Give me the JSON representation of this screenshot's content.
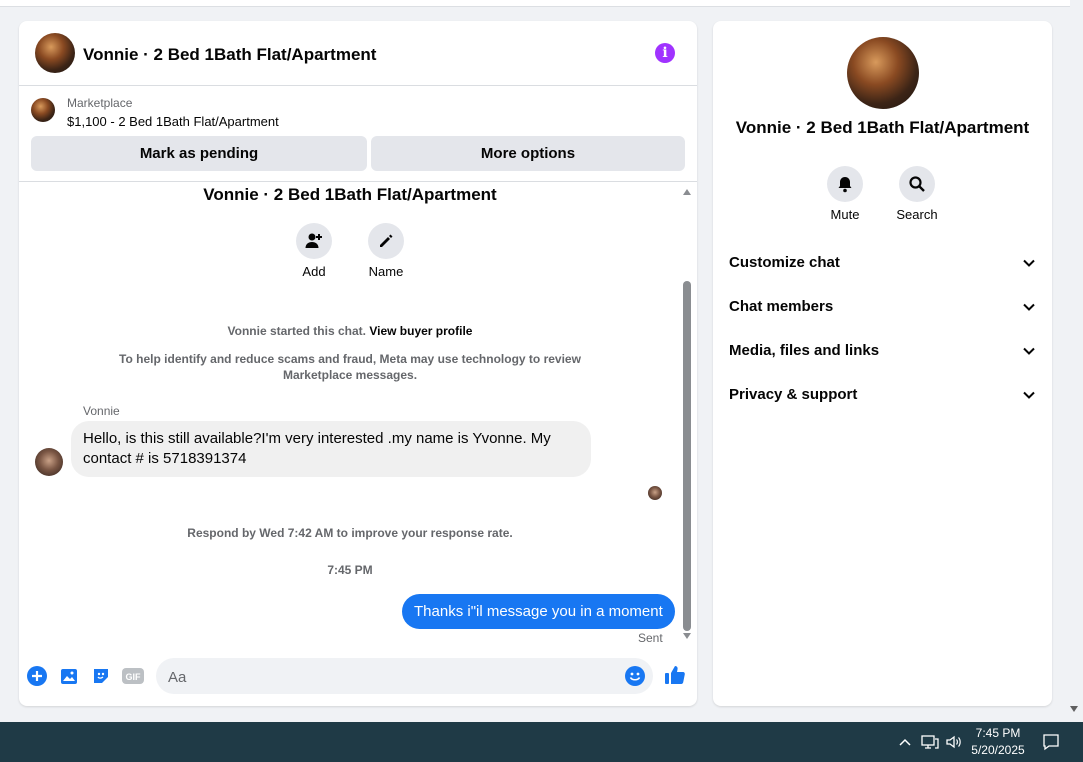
{
  "chat": {
    "title": "Vonnie · 2 Bed 1Bath Flat/Apartment",
    "marketplace_label": "Marketplace",
    "listing": "$1,100 - 2 Bed 1Bath Flat/Apartment",
    "mark_pending_label": "Mark as pending",
    "more_options_label": "More options",
    "thread_title": "Vonnie · 2 Bed 1Bath Flat/Apartment",
    "add_label": "Add",
    "name_label": "Name",
    "started_text": "Vonnie started this chat.",
    "view_profile_link": "View buyer profile",
    "notice_line1": "To help identify and reduce scams and fraud, Meta may use technology to review",
    "notice_line2": "Marketplace messages.",
    "messages": [
      {
        "sender": "Vonnie",
        "text": "Hello, is this still available?I'm very interested .my name is Yvonne. My contact # is 5718391374"
      }
    ],
    "respond_notice": "Respond by Wed 7:42 AM to improve your response rate.",
    "timestamp": "7:45 PM",
    "outgoing_text": "Thanks i\"il message you in a moment",
    "sent_status": "Sent",
    "composer_placeholder": "Aa"
  },
  "sidebar": {
    "title": "Vonnie · 2 Bed 1Bath Flat/Apartment",
    "mute_label": "Mute",
    "search_label": "Search",
    "sections": [
      {
        "label": "Customize chat"
      },
      {
        "label": "Chat members"
      },
      {
        "label": "Media, files and links"
      },
      {
        "label": "Privacy & support"
      }
    ]
  },
  "taskbar": {
    "time": "7:45 PM",
    "date": "5/20/2025"
  },
  "colors": {
    "accent": "#1877f2",
    "info": "#a033ff",
    "taskbar": "#1f3a46"
  }
}
